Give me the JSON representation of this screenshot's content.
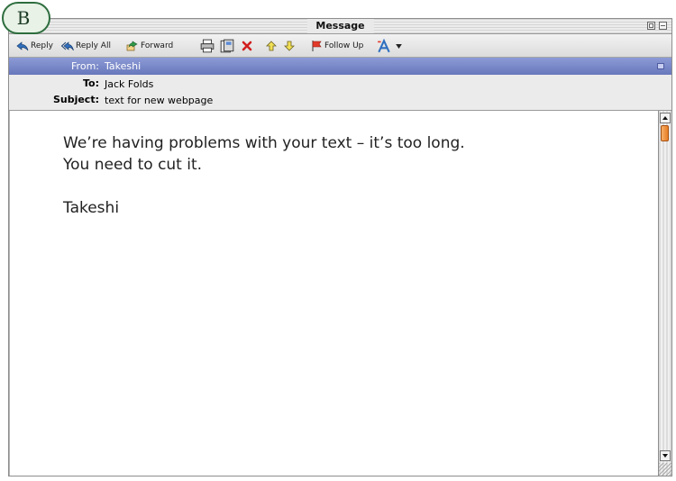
{
  "badge": "B",
  "window": {
    "title": "Message"
  },
  "toolbar": {
    "reply": "Reply",
    "reply_all": "Reply All",
    "forward": "Forward",
    "follow_up": "Follow Up"
  },
  "header": {
    "from_label": "From:",
    "from_value": "Takeshi",
    "to_label": "To:",
    "to_value": "Jack Folds",
    "subject_label": "Subject:",
    "subject_value": "text for new webpage"
  },
  "body": {
    "line1": "We’re having problems with your text – it’s too long.",
    "line2": "You need to cut it.",
    "signature": "Takeshi"
  },
  "icons": [
    "reply-icon",
    "reply-all-icon",
    "forward-icon",
    "print-icon",
    "save-icon",
    "delete-icon",
    "previous-icon",
    "next-icon",
    "flag-icon",
    "font-icon",
    "dropdown-arrow-icon"
  ],
  "colors": {
    "from_bar": "#7886c6",
    "scroll_thumb": "#ee8a36",
    "badge_border": "#2d6d3e"
  }
}
